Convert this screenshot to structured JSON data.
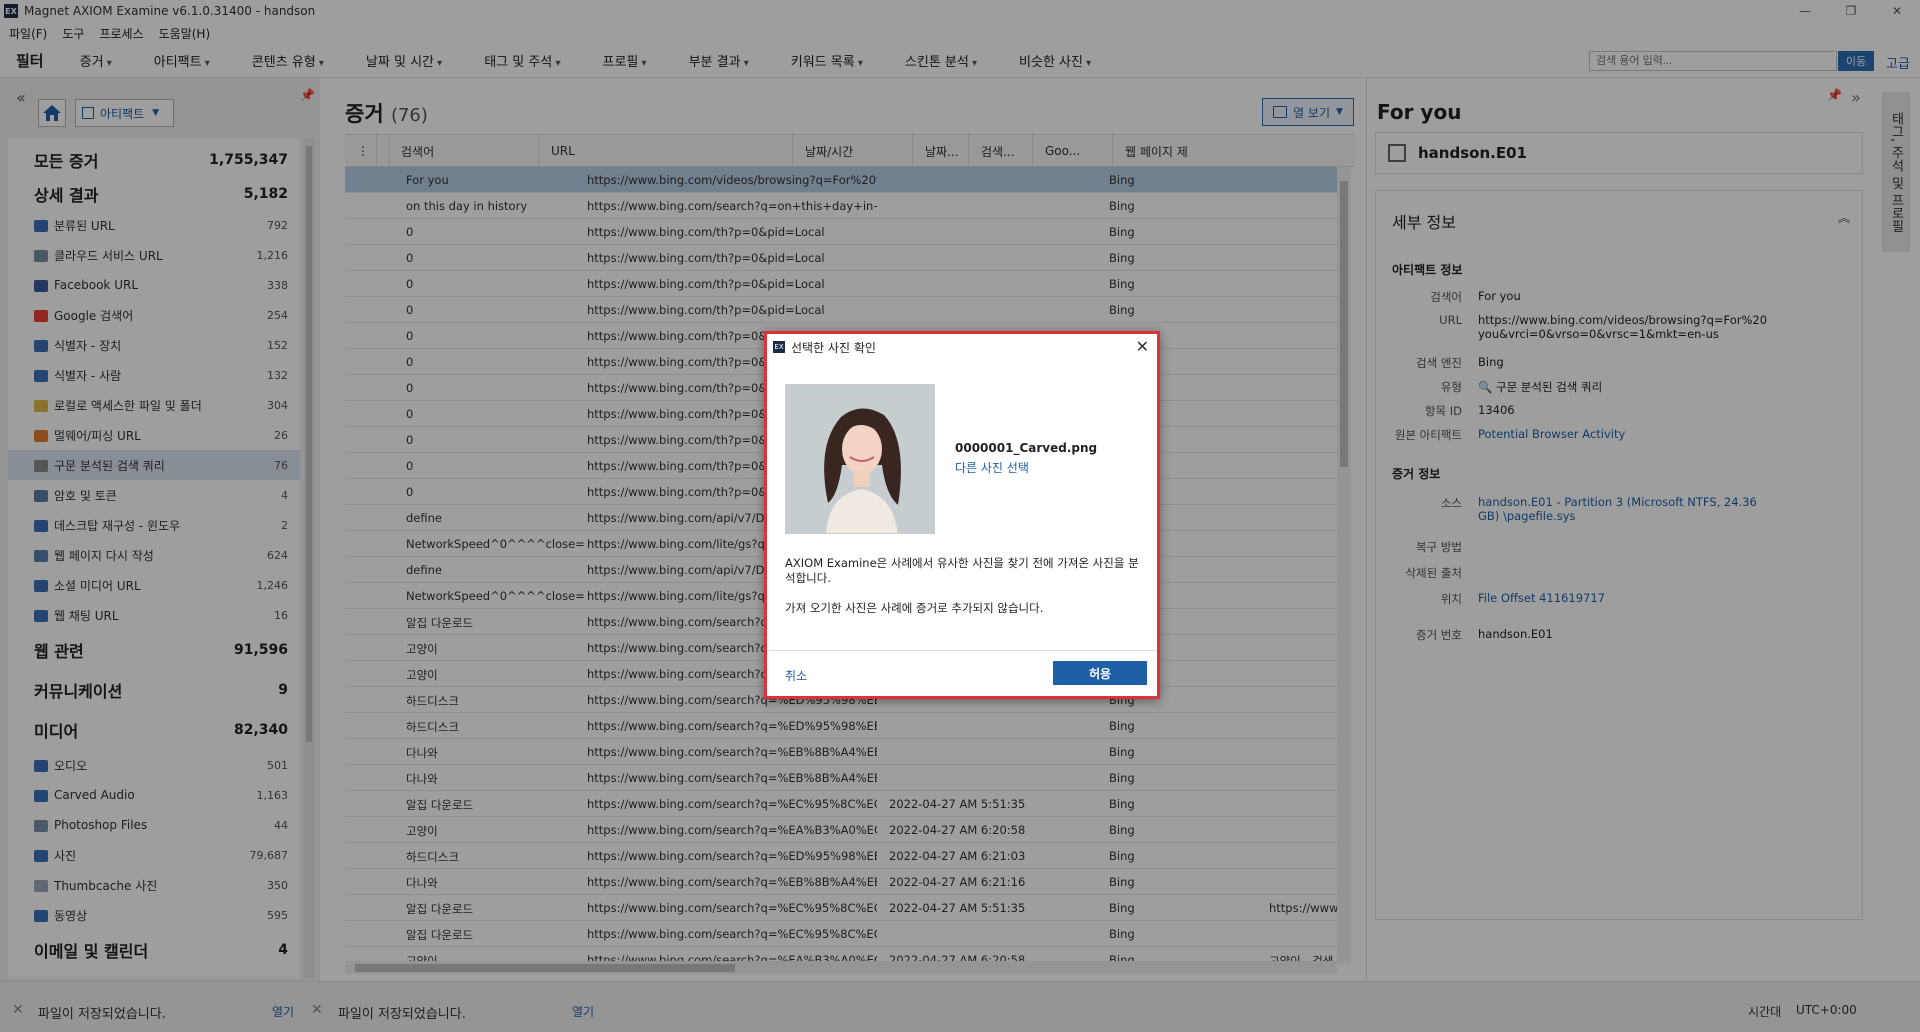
{
  "window": {
    "title": "Magnet AXIOM Examine v6.1.0.31400 - handson",
    "app_icon": "EX",
    "minimize": "—",
    "maximize": "❐",
    "close": "✕"
  },
  "menu": [
    "파일(F)",
    "도구",
    "프로세스",
    "도움말(H)"
  ],
  "filterbar": {
    "label": "필터",
    "items": [
      "증거",
      "아티팩트",
      "콘텐츠 유형",
      "날짜 및 시간",
      "태그 및 주석",
      "프로필",
      "부분 결과",
      "키워드 목록",
      "스킨톤 분석",
      "비슷한 사진"
    ],
    "search_placeholder": "검색 용어 입력...",
    "go_label": "이동",
    "advanced_label": "고급"
  },
  "leftpanel": {
    "collapse": "«",
    "artifact_select": "아티팩트",
    "groups": [
      {
        "label": "모든 증거",
        "count": "1,755,347"
      },
      {
        "label": "상세 결과",
        "count": "5,182"
      },
      {
        "label": "웹 관련",
        "count": "91,596"
      },
      {
        "label": "커뮤니케이션",
        "count": "9"
      },
      {
        "label": "미디어",
        "count": "82,340"
      },
      {
        "label": "이메일 및 캘린더",
        "count": "4"
      }
    ],
    "refined": [
      {
        "label": "분류된 URL",
        "count": "792",
        "color": "#3b6fb6"
      },
      {
        "label": "클라우드 서비스 URL",
        "count": "1,216",
        "color": "#7a8ea8"
      },
      {
        "label": "Facebook URL",
        "count": "338",
        "color": "#3b5998"
      },
      {
        "label": "Google 검색어",
        "count": "254",
        "color": "#e94235"
      },
      {
        "label": "식별자 - 장치",
        "count": "152",
        "color": "#3b6fb6"
      },
      {
        "label": "식별자 - 사람",
        "count": "132",
        "color": "#3b6fb6"
      },
      {
        "label": "로컬로 액세스한 파일 및 폴더",
        "count": "304",
        "color": "#e0b84a"
      },
      {
        "label": "멀웨어/피싱 URL",
        "count": "26",
        "color": "#e07a2a"
      },
      {
        "label": "구문 분석된 검색 쿼리",
        "count": "76",
        "color": "#8a8a8a"
      },
      {
        "label": "암호 및 토큰",
        "count": "4",
        "color": "#5a7ea8"
      },
      {
        "label": "데스크탑 재구성 - 윈도우",
        "count": "2",
        "color": "#3b6fb6"
      },
      {
        "label": "웹 페이지 다시 작성",
        "count": "624",
        "color": "#5a7ea8"
      },
      {
        "label": "소셜 미디어 URL",
        "count": "1,246",
        "color": "#3b6fb6"
      },
      {
        "label": "웹 채팅 URL",
        "count": "16",
        "color": "#3b6fb6"
      }
    ],
    "media": [
      {
        "label": "오디오",
        "count": "501",
        "color": "#3b6fb6"
      },
      {
        "label": "Carved Audio",
        "count": "1,163",
        "color": "#3b6fb6"
      },
      {
        "label": "Photoshop Files",
        "count": "44",
        "color": "#7a8ea8"
      },
      {
        "label": "사진",
        "count": "79,687",
        "color": "#3b6fb6"
      },
      {
        "label": "Thumbcache 사진",
        "count": "350",
        "color": "#9aa8b8"
      },
      {
        "label": "동영상",
        "count": "595",
        "color": "#3b6fb6"
      }
    ]
  },
  "evidence": {
    "title": "증거",
    "count": "(76)",
    "column_button": "열 보기",
    "columns": [
      "검색어",
      "URL",
      "날짜/시간",
      "날짜...",
      "검색...",
      "Goo...",
      "웹 페이지 제"
    ],
    "rows": [
      {
        "q": "For you",
        "url": "https://www.bing.com/videos/browsing?q=For%20y...",
        "dt": "",
        "eng": "Bing",
        "extra": ""
      },
      {
        "q": "on this day in history",
        "url": "https://www.bing.com/search?q=on+this+day+in+...",
        "dt": "",
        "eng": "Bing",
        "extra": ""
      },
      {
        "q": "0",
        "url": "https://www.bing.com/th?p=0&pid=Local",
        "dt": "",
        "eng": "Bing",
        "extra": ""
      },
      {
        "q": "0",
        "url": "https://www.bing.com/th?p=0&pid=Local",
        "dt": "",
        "eng": "Bing",
        "extra": ""
      },
      {
        "q": "0",
        "url": "https://www.bing.com/th?p=0&pid=Local",
        "dt": "",
        "eng": "Bing",
        "extra": ""
      },
      {
        "q": "0",
        "url": "https://www.bing.com/th?p=0&pid=Local",
        "dt": "",
        "eng": "Bing",
        "extra": ""
      },
      {
        "q": "0",
        "url": "https://www.bing.com/th?p=0&p",
        "dt": "",
        "eng": "",
        "extra": ""
      },
      {
        "q": "0",
        "url": "https://www.bing.com/th?p=0&p",
        "dt": "",
        "eng": "",
        "extra": ""
      },
      {
        "q": "0",
        "url": "https://www.bing.com/th?p=0&p",
        "dt": "",
        "eng": "",
        "extra": ""
      },
      {
        "q": "0",
        "url": "https://www.bing.com/th?p=0&p",
        "dt": "",
        "eng": "",
        "extra": ""
      },
      {
        "q": "0",
        "url": "https://www.bing.com/th?p=0&p",
        "dt": "",
        "eng": "",
        "extra": ""
      },
      {
        "q": "0",
        "url": "https://www.bing.com/th?p=0&p",
        "dt": "",
        "eng": "",
        "extra": ""
      },
      {
        "q": "0",
        "url": "https://www.bing.com/th?p=0&p",
        "dt": "",
        "eng": "",
        "extra": ""
      },
      {
        "q": "define",
        "url": "https://www.bing.com/api/v7/Dic",
        "dt": "",
        "eng": "",
        "extra": ""
      },
      {
        "q": "NetworkSpeed^0^^^^close=1",
        "url": "https://www.bing.com/lite/gs?q=",
        "dt": "",
        "eng": "",
        "extra": ""
      },
      {
        "q": "define",
        "url": "https://www.bing.com/api/v7/Dic",
        "dt": "",
        "eng": "",
        "extra": ""
      },
      {
        "q": "NetworkSpeed^0^^^^close=1",
        "url": "https://www.bing.com/lite/gs?q=",
        "dt": "",
        "eng": "",
        "extra": ""
      },
      {
        "q": "알집 다운로드",
        "url": "https://www.bing.com/search?q=",
        "dt": "",
        "eng": "",
        "extra": ""
      },
      {
        "q": "고양이",
        "url": "https://www.bing.com/search?q=",
        "dt": "",
        "eng": "",
        "extra": ""
      },
      {
        "q": "고양이",
        "url": "https://www.bing.com/search?q=",
        "dt": "",
        "eng": "",
        "extra": ""
      },
      {
        "q": "하드디스크",
        "url": "https://www.bing.com/search?q=%ED%95%98%EB...",
        "dt": "",
        "eng": "Bing",
        "extra": ""
      },
      {
        "q": "하드디스크",
        "url": "https://www.bing.com/search?q=%ED%95%98%EB...",
        "dt": "",
        "eng": "Bing",
        "extra": ""
      },
      {
        "q": "다나와",
        "url": "https://www.bing.com/search?q=%EB%8B%A4%EB...",
        "dt": "",
        "eng": "Bing",
        "extra": ""
      },
      {
        "q": "다나와",
        "url": "https://www.bing.com/search?q=%EB%8B%A4%EB...",
        "dt": "",
        "eng": "Bing",
        "extra": ""
      },
      {
        "q": "알집 다운로드",
        "url": "https://www.bing.com/search?q=%EC%95%8C%EC...",
        "dt": "2022-04-27 AM 5:51:35",
        "eng": "Bing",
        "extra": ""
      },
      {
        "q": "고양이",
        "url": "https://www.bing.com/search?q=%EA%B3%A0%EC...",
        "dt": "2022-04-27 AM 6:20:58",
        "eng": "Bing",
        "extra": ""
      },
      {
        "q": "하드디스크",
        "url": "https://www.bing.com/search?q=%ED%95%98%EB...",
        "dt": "2022-04-27 AM 6:21:03",
        "eng": "Bing",
        "extra": ""
      },
      {
        "q": "다나와",
        "url": "https://www.bing.com/search?q=%EB%8B%A4%EB...",
        "dt": "2022-04-27 AM 6:21:16",
        "eng": "Bing",
        "extra": ""
      },
      {
        "q": "알집 다운로드",
        "url": "https://www.bing.com/search?q=%EC%95%8C%EC...",
        "dt": "2022-04-27 AM 5:51:35",
        "eng": "Bing",
        "extra": "https://www..."
      },
      {
        "q": "알집 다운로드",
        "url": "https://www.bing.com/search?q=%EC%95%8C%EC...",
        "dt": "",
        "eng": "Bing",
        "extra": ""
      },
      {
        "q": "고양이",
        "url": "https://www.bing.com/search?q=%EA%B3%A0%EC...",
        "dt": "2022-04-27 AM 6:20:58",
        "eng": "Bing",
        "extra": "고양이 - 검색"
      }
    ]
  },
  "rightpanel": {
    "title": "For you",
    "case": "handson.E01",
    "detail_header": "세부 정보",
    "artifact_section": "아티팩트 정보",
    "evidence_section": "증거 정보",
    "fields": {
      "search_term_k": "검색어",
      "search_term_v": "For you",
      "url_k": "URL",
      "url_v": "https://www.bing.com/videos/browsing?q=For%20you&vrci=0&vrso=0&vrsc=1&mkt=en-us",
      "engine_k": "검색 엔진",
      "engine_v": "Bing",
      "type_k": "유형",
      "type_v": "구문 분석된 검색 쿼리",
      "id_k": "항목 ID",
      "id_v": "13406",
      "origin_k": "원본 아티팩트",
      "origin_v": "Potential Browser Activity",
      "source_k": "소스",
      "source_v": "handson.E01 - Partition 3 (Microsoft NTFS, 24.36 GB) \\pagefile.sys",
      "recovery_k": "복구 방법",
      "deleted_k": "삭제된 출처",
      "location_k": "위치",
      "location_v": "File Offset 411619717",
      "evnum_k": "증거 번호",
      "evnum_v": "handson.E01"
    },
    "side_tab": "태그, 주석 및 프로필"
  },
  "status": {
    "msg1": "파일이 저장되었습니다.",
    "open1": "열기",
    "msg2": "파일이 저장되었습니다.",
    "open2": "열기",
    "tz_label": "시간대",
    "tz_value": "UTC+0:00"
  },
  "dialog": {
    "title": "선택한 사진 확인",
    "filename": "0000001_Carved.png",
    "other_photo": "다른 사진 선택",
    "msg1": "AXIOM Examine은 사례에서 유사한 사진을 찾기 전에 가져온 사진을 분석합니다.",
    "msg2": "가져 오기한 사진은 사례에 증거로 추가되지 않습니다.",
    "cancel": "취소",
    "allow": "허용",
    "close": "✕"
  }
}
